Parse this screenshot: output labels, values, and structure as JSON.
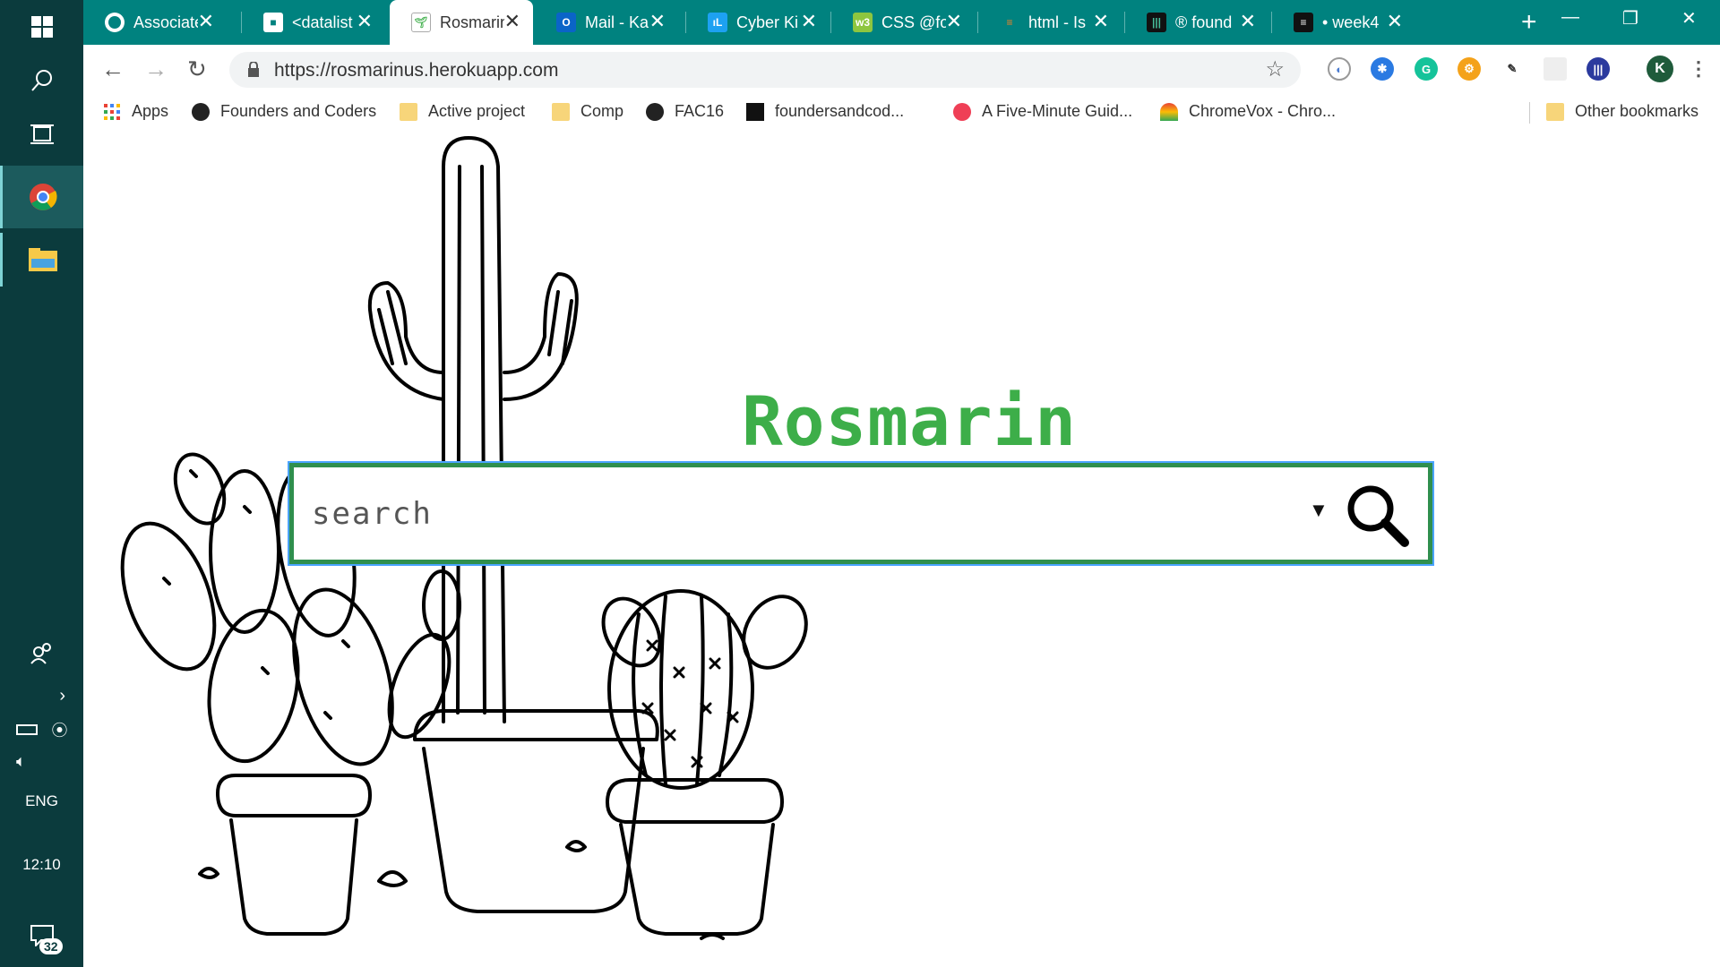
{
  "taskbar": {
    "language": "ENG",
    "time": "12:10",
    "notification_count": "32"
  },
  "tabs": [
    {
      "label": "Associate",
      "icon": "github-icon"
    },
    {
      "label": "<datalist",
      "icon": "mdn-icon"
    },
    {
      "label": "Rosmarin",
      "icon": "rosmarin-sprout-icon",
      "active": true
    },
    {
      "label": "Mail - Ka",
      "icon": "outlook-icon"
    },
    {
      "label": "Cyber Ki",
      "icon": "cyber-icon"
    },
    {
      "label": "CSS @fo",
      "icon": "w3schools-icon"
    },
    {
      "label": "html - Is",
      "icon": "stackoverflow-icon"
    },
    {
      "label": "® found",
      "icon": "gitter-icon"
    },
    {
      "label": "• week4",
      "icon": "document-icon"
    }
  ],
  "address_bar": {
    "url": "https://rosmarinus.herokuapp.com"
  },
  "profile_initial": "K",
  "bookmarks": [
    {
      "label": "Apps",
      "icon": "apps-grid-icon"
    },
    {
      "label": "Founders and Coders",
      "icon": "github-icon"
    },
    {
      "label": "Active project",
      "icon": "folder-icon"
    },
    {
      "label": "Comp",
      "icon": "folder-icon"
    },
    {
      "label": "FAC16",
      "icon": "github-icon"
    },
    {
      "label": "foundersandcod...",
      "icon": "gitter-icon"
    },
    {
      "label": "A Five-Minute Guid...",
      "icon": "pocket-icon"
    },
    {
      "label": "ChromeVox - Chro...",
      "icon": "chromevox-icon"
    }
  ],
  "other_bookmarks": "Other bookmarks",
  "page": {
    "title": "Rosmarin",
    "search_placeholder": "search"
  },
  "colors": {
    "tabbar": "#00827f",
    "taskbar": "#0b3b3d",
    "title_green": "#3dae49",
    "search_border": "#2f8f4e"
  }
}
